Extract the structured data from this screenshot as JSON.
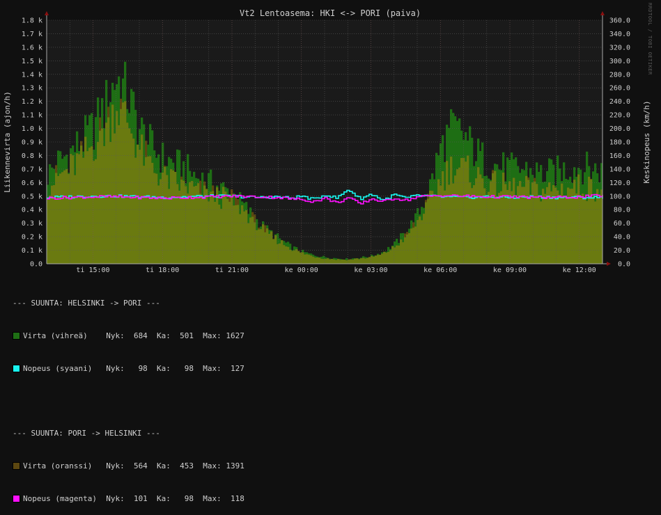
{
  "colors": {
    "background": "#101010",
    "plot_bg": "#1a1a1a",
    "grid": "#5a5a5a",
    "text": "#cfcfcf",
    "green": "#1e6e14",
    "orange": "#5c4710",
    "olive": "#6a7a10",
    "cyan": "#19f5f0",
    "magenta": "#ff10ff"
  },
  "side_text": "RRDTOOL / TOBI OETIKER",
  "legend": {
    "group1_header": "--- SUUNTA: HELSINKI -> PORI ---",
    "group2_header": "--- SUUNTA: PORI -> HELSINKI ---",
    "rows": [
      {
        "label": "Virta (vihreä)    Nyk:  684  Ka:  501  Max: 1627",
        "color": "#1e6e14"
      },
      {
        "label": "Nopeus (syaani)   Nyk:   98  Ka:   98  Max:  127",
        "color": "#19f5f0"
      },
      {
        "label": "Virta (oranssi)   Nyk:  564  Ka:  453  Max: 1391",
        "color": "#5c4710"
      },
      {
        "label": "Nopeus (magenta)  Nyk:  101  Ka:   98  Max:  118",
        "color": "#ff10ff"
      }
    ]
  },
  "chart_data": {
    "type": "area",
    "title": "Vt2 Lentoasema: HKI <-> PORI (paiva)",
    "ylabel": "Liikennevirta (ajon/h)",
    "y2label": "Keskinopeus (km/h)",
    "ylim": [
      0,
      1800
    ],
    "y2lim": [
      0,
      360
    ],
    "y_ticks": [
      "0.0",
      "0.1 k",
      "0.2 k",
      "0.3 k",
      "0.4 k",
      "0.5 k",
      "0.6 k",
      "0.7 k",
      "0.8 k",
      "0.9 k",
      "1.0 k",
      "1.1 k",
      "1.2 k",
      "1.3 k",
      "1.4 k",
      "1.5 k",
      "1.6 k",
      "1.7 k",
      "1.8 k"
    ],
    "y2_ticks": [
      "0.0",
      "20.0",
      "40.0",
      "60.0",
      "80.0",
      "100.0",
      "120.0",
      "140.0",
      "160.0",
      "180.0",
      "200.0",
      "220.0",
      "240.0",
      "260.0",
      "280.0",
      "300.0",
      "320.0",
      "340.0",
      "360.0"
    ],
    "x_hours_range": [
      13,
      37
    ],
    "x_ticks": [
      {
        "hour": 15,
        "label": "ti 15:00"
      },
      {
        "hour": 18,
        "label": "ti 18:00"
      },
      {
        "hour": 21,
        "label": "ti 21:00"
      },
      {
        "hour": 24,
        "label": "ke 00:00"
      },
      {
        "hour": 27,
        "label": "ke 03:00"
      },
      {
        "hour": 30,
        "label": "ke 06:00"
      },
      {
        "hour": 33,
        "label": "ke 09:00"
      },
      {
        "hour": 36,
        "label": "ke 12:00"
      }
    ],
    "grid": true,
    "legend": "bottom-left",
    "series": [
      {
        "name": "Virta (vihreä)",
        "axis": "left",
        "x": [
          13.0,
          13.5,
          14.0,
          14.5,
          15.0,
          15.5,
          16.0,
          16.5,
          17.0,
          17.5,
          18.0,
          18.5,
          19.0,
          19.5,
          20.0,
          20.5,
          21.0,
          21.5,
          22.0,
          22.5,
          23.0,
          23.5,
          24.0,
          24.5,
          25.0,
          25.5,
          26.0,
          26.5,
          27.0,
          27.5,
          28.0,
          28.5,
          29.0,
          29.5,
          30.0,
          30.5,
          31.0,
          31.5,
          32.0,
          32.5,
          33.0,
          33.5,
          34.0,
          34.5,
          35.0,
          35.5,
          36.0,
          36.5,
          37.0
        ],
        "values": [
          650,
          750,
          820,
          900,
          1000,
          1150,
          1380,
          1250,
          1000,
          870,
          780,
          740,
          700,
          640,
          600,
          560,
          520,
          430,
          330,
          250,
          190,
          130,
          90,
          65,
          50,
          40,
          35,
          45,
          55,
          85,
          140,
          230,
          350,
          540,
          850,
          1000,
          950,
          830,
          750,
          720,
          700,
          700,
          680,
          660,
          680,
          700,
          720,
          700,
          684
        ]
      },
      {
        "name": "Nopeus (syaani)",
        "axis": "right",
        "x": [
          13.0,
          14.0,
          15.0,
          16.0,
          17.0,
          18.0,
          19.0,
          20.0,
          21.0,
          22.0,
          23.0,
          23.5,
          24.0,
          24.5,
          25.0,
          25.5,
          26.0,
          26.5,
          27.0,
          27.5,
          28.0,
          28.5,
          29.0,
          29.5,
          30.0,
          31.0,
          32.0,
          33.0,
          34.0,
          35.0,
          36.0,
          37.0
        ],
        "values": [
          98,
          99,
          100,
          100,
          99,
          98,
          99,
          100,
          100,
          98,
          99,
          97,
          100,
          95,
          102,
          97,
          110,
          96,
          103,
          94,
          102,
          97,
          101,
          100,
          99,
          98,
          99,
          98,
          99,
          98,
          98,
          98
        ]
      },
      {
        "name": "Virta (oranssi)",
        "axis": "left",
        "x": [
          13.0,
          13.5,
          14.0,
          14.5,
          15.0,
          15.5,
          16.0,
          16.5,
          17.0,
          17.5,
          18.0,
          18.5,
          19.0,
          19.5,
          20.0,
          20.5,
          21.0,
          21.5,
          22.0,
          22.5,
          23.0,
          23.5,
          24.0,
          24.5,
          25.0,
          25.5,
          26.0,
          26.5,
          27.0,
          27.5,
          28.0,
          28.5,
          29.0,
          29.5,
          30.0,
          30.5,
          31.0,
          31.5,
          32.0,
          32.5,
          33.0,
          33.5,
          34.0,
          34.5,
          35.0,
          35.5,
          36.0,
          36.5,
          37.0
        ],
        "values": [
          580,
          640,
          700,
          780,
          880,
          1000,
          1180,
          1050,
          850,
          720,
          640,
          600,
          570,
          540,
          520,
          490,
          470,
          400,
          310,
          230,
          170,
          120,
          80,
          55,
          40,
          32,
          30,
          38,
          48,
          70,
          120,
          200,
          310,
          450,
          620,
          720,
          700,
          650,
          600,
          580,
          560,
          560,
          550,
          540,
          550,
          560,
          570,
          560,
          564
        ]
      },
      {
        "name": "Nopeus (magenta)",
        "axis": "right",
        "x": [
          13.0,
          14.0,
          15.0,
          16.0,
          17.0,
          18.0,
          19.0,
          20.0,
          21.0,
          22.0,
          23.0,
          23.5,
          24.0,
          24.5,
          25.0,
          25.5,
          26.0,
          26.5,
          27.0,
          27.5,
          28.0,
          28.5,
          29.0,
          29.5,
          30.0,
          31.0,
          32.0,
          33.0,
          34.0,
          35.0,
          36.0,
          37.0
        ],
        "values": [
          97,
          98,
          99,
          99,
          98,
          97,
          98,
          99,
          100,
          99,
          98,
          96,
          95,
          92,
          97,
          90,
          98,
          88,
          96,
          92,
          97,
          94,
          99,
          100,
          101,
          100,
          99,
          99,
          98,
          98,
          99,
          101
        ]
      }
    ]
  }
}
